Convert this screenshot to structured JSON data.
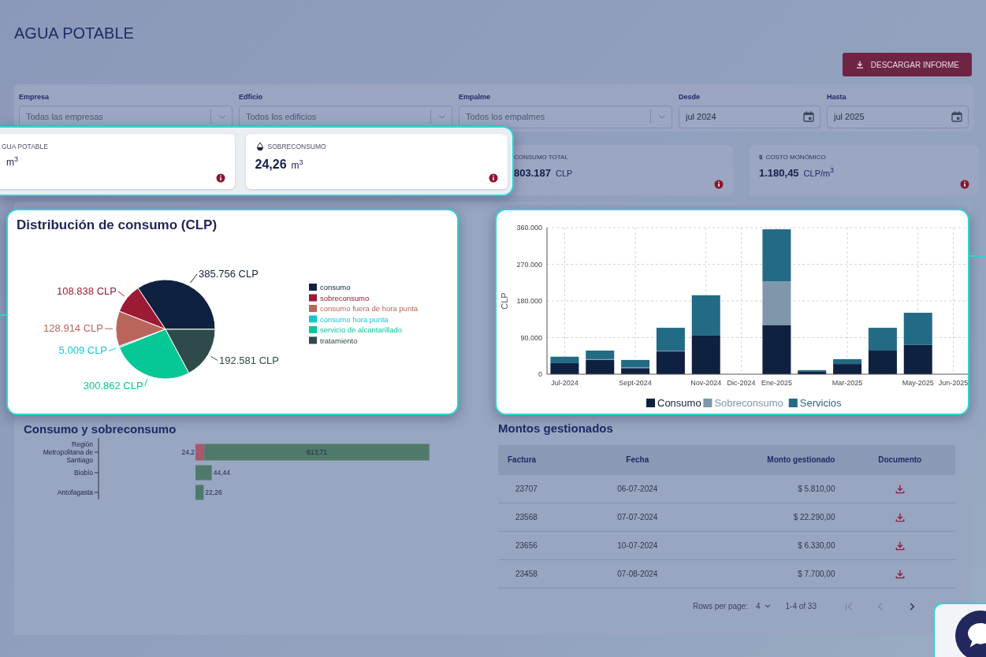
{
  "page": {
    "title": "AGUA POTABLE",
    "download_button": "DESCARGAR INFORME"
  },
  "filters": [
    {
      "kind": "select",
      "label": "Empresa",
      "placeholder": "Todas las empresas"
    },
    {
      "kind": "select",
      "label": "Edficio",
      "placeholder": "Todos los edificios"
    },
    {
      "kind": "select",
      "label": "Empalme",
      "placeholder": "Todos los empalmes"
    },
    {
      "kind": "date",
      "label": "Desde",
      "value": "jul 2024"
    },
    {
      "kind": "date",
      "label": "Hasta",
      "value": "jul 2025"
    }
  ],
  "kpi_highlight": {
    "cards": [
      {
        "title": "GUA POTABLE",
        "unit": "m$^{3}$"
      },
      {
        "title": "SOBRECONSUMO",
        "value": "24,26",
        "unit": "m$^{3}$"
      }
    ]
  },
  "kpi_cards": [
    {
      "title": "CONSUMO TOTAL",
      "value": "803.187",
      "unit": "CLP"
    },
    {
      "symbol": "$",
      "title": "COSTO MONÓMICO",
      "value": "1.180,45",
      "unit": "CLP/m$^{3}$"
    }
  ],
  "distribution_card": {
    "title": "Distribución de consumo (CLP)",
    "chart_data": {
      "type": "pie",
      "legend": "right",
      "categories": [
        "consumo",
        "sobreconsumo",
        "consumo fuera de hora punta",
        "consumo hora punta",
        "servicio de alcantarillado",
        "tratamiento"
      ],
      "values": [
        385756,
        108838,
        128914,
        5009,
        300862,
        192581
      ],
      "colors": [
        "#0f2140",
        "#9b1b35",
        "#b9655b",
        "#17c7cf",
        "#06c896",
        "#2f4a4a"
      ],
      "value_labels": [
        "385.756 CLP",
        "108.838 CLP",
        "128.914 CLP",
        "5.009 CLP",
        "300.862 CLP",
        "192.581 CLP"
      ]
    }
  },
  "monthly_card": {
    "chart_data": {
      "type": "bar",
      "stacked": true,
      "grid": true,
      "legend": "bottom",
      "ylabel": "CLP",
      "categories": [
        "Jul-2024",
        null,
        "Sept-2024",
        null,
        "Nov-2024",
        "Dic-2024",
        "Ene-2025",
        null,
        "Mar-2025",
        null,
        "May-2025",
        "Jun-2025"
      ],
      "ylim": [
        0,
        360000
      ],
      "yticks": [
        {
          "value": 0,
          "label": "0"
        },
        {
          "value": 90000,
          "label": "90.000"
        },
        {
          "value": 180000,
          "label": "180.000"
        },
        {
          "value": 270000,
          "label": "270.000"
        },
        {
          "value": 360000,
          "label": "360.000"
        }
      ],
      "series": [
        {
          "name": "Consumo",
          "color": "#0f2140",
          "values": [
            27000,
            35000,
            15000,
            56000,
            95000,
            null,
            120000,
            6000,
            25000,
            58000,
            72000,
            null
          ]
        },
        {
          "name": "Sobreconsumo",
          "color": "#7f97ab",
          "values": [
            0,
            2000,
            2000,
            2000,
            0,
            null,
            108000,
            0,
            0,
            0,
            0,
            null
          ]
        },
        {
          "name": "Servicios",
          "color": "#236a85",
          "values": [
            16000,
            21000,
            18000,
            56000,
            99000,
            null,
            128000,
            4000,
            12000,
            56000,
            79000,
            null
          ]
        }
      ]
    }
  },
  "consumption_card": {
    "title": "Consumo y sobreconsumo",
    "chart_data": {
      "type": "bar",
      "orientation": "horizontal",
      "stacked": true,
      "categories": [
        "Región Metropolitana de Santiago",
        "Biobío",
        "Antofagasta"
      ],
      "series": [
        {
          "color": "#a8596f",
          "values": [
            24.2,
            null,
            null
          ],
          "value_labels": [
            "24,2",
            null,
            null
          ]
        },
        {
          "color": "#4f7a6b",
          "values": [
            613.71,
            44.44,
            22.26
          ],
          "value_labels": [
            "613,71",
            "44,44",
            "22,26"
          ]
        }
      ]
    }
  },
  "invoices": {
    "title": "Montos gestionados",
    "columns": [
      "Factura",
      "Fecha",
      "Monto gestionado",
      "Documento"
    ],
    "rows": [
      {
        "factura": "23707",
        "fecha": "06-07-2024",
        "monto": "$ 5.810,00"
      },
      {
        "factura": "23568",
        "fecha": "07-07-2024",
        "monto": "$ 22.290,00"
      },
      {
        "factura": "23656",
        "fecha": "10-07-2024",
        "monto": "$ 6.330,00"
      },
      {
        "factura": "23458",
        "fecha": "07-08-2024",
        "monto": "$ 7.700,00"
      }
    ],
    "pagination": {
      "rows_label": "Rows per page:",
      "rows_value": "4",
      "range": "1-4 of 33"
    }
  }
}
